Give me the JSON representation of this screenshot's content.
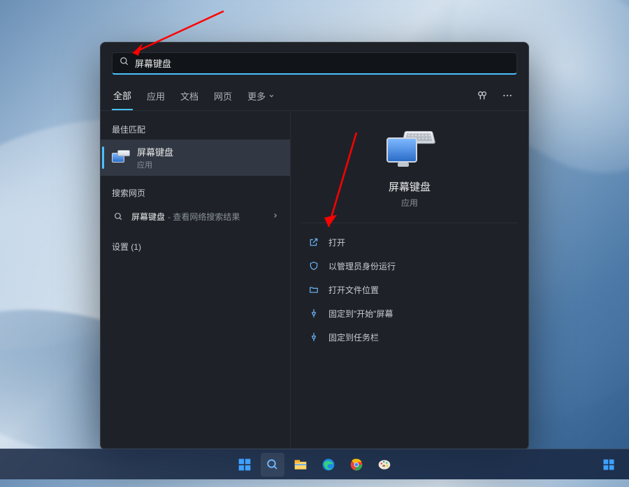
{
  "search": {
    "query": "屏幕键盘"
  },
  "tabs": {
    "all": "全部",
    "apps": "应用",
    "docs": "文档",
    "web": "网页",
    "more": "更多"
  },
  "left": {
    "bestMatchHeader": "最佳匹配",
    "bestMatch": {
      "title": "屏幕键盘",
      "subtitle": "应用"
    },
    "webHeader": "搜索网页",
    "webItem": {
      "query": "屏幕键盘",
      "suffix": " - 查看网络搜索结果"
    },
    "settingsHeader": "设置 (1)"
  },
  "preview": {
    "title": "屏幕键盘",
    "subtitle": "应用",
    "actions": {
      "open": "打开",
      "runAdmin": "以管理员身份运行",
      "openLocation": "打开文件位置",
      "pinStart": "固定到\"开始\"屏幕",
      "pinTaskbar": "固定到任务栏"
    }
  },
  "icons": {
    "search": "search-icon",
    "chevronDown": "chevron-down-icon",
    "chevronRight": "chevron-right-icon",
    "rewards": "rewards-icon",
    "more": "more-icon",
    "externalLink": "external-link-icon",
    "shield": "shield-icon",
    "folderOpen": "folder-open-icon",
    "pin": "pin-icon"
  }
}
